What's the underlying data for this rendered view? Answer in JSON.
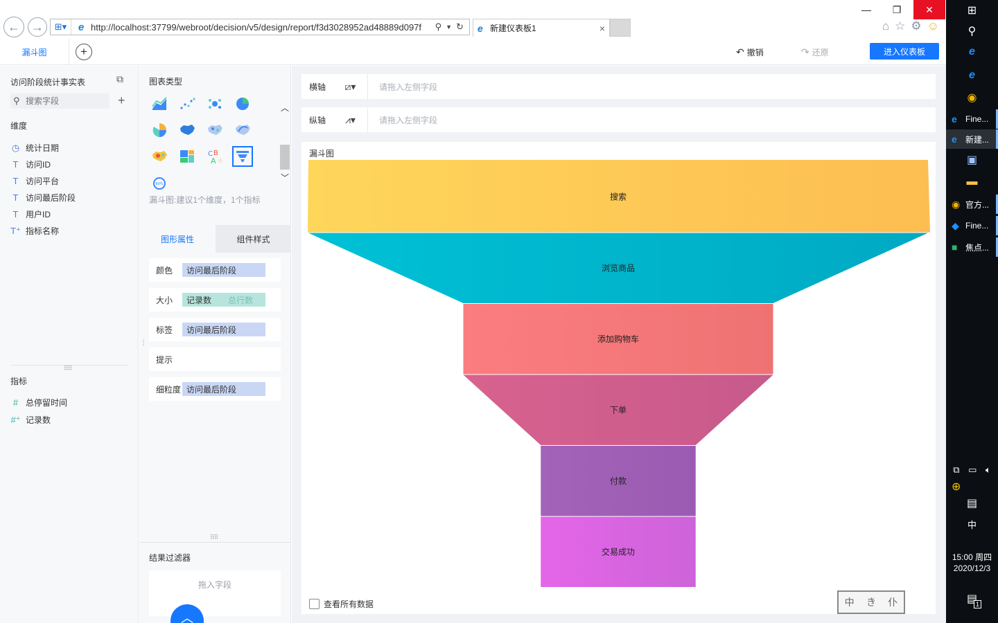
{
  "browser": {
    "url": "http://localhost:37799/webroot/decision/v5/design/report/f3d3028952ad48889d097f",
    "tab_title": "新建仪表板1",
    "tab_close": "×"
  },
  "header": {
    "active_tab": "漏斗图",
    "undo_label": "撤销",
    "redo_label": "还原",
    "enter_dashboard_label": "进入仪表板"
  },
  "data_panel": {
    "table_name": "访问阶段统计事实表",
    "search_placeholder": "搜索字段",
    "dimension_title": "维度",
    "dimensions": [
      {
        "icon": "clock-icon",
        "label": "统计日期"
      },
      {
        "icon": "text-field-icon",
        "label": "访问ID"
      },
      {
        "icon": "text-field-icon",
        "label": "访问平台"
      },
      {
        "icon": "text-field-icon",
        "label": "访问最后阶段"
      },
      {
        "icon": "text-field-icon",
        "label": "用户ID"
      },
      {
        "icon": "text-calc-field-icon",
        "label": "指标名称"
      }
    ],
    "metric_title": "指标",
    "metrics": [
      {
        "icon": "number-field-icon",
        "label": "总停留时间"
      },
      {
        "icon": "number-calc-field-icon",
        "label": "记录数"
      }
    ]
  },
  "config_panel": {
    "chart_type_title": "图表类型",
    "chart_types": [
      {
        "name": "area-chart-icon"
      },
      {
        "name": "scatter-chart-icon"
      },
      {
        "name": "bubble-chart-icon"
      },
      {
        "name": "pie-chart-icon"
      },
      {
        "name": "multi-pie-chart-icon"
      },
      {
        "name": "area-map-icon"
      },
      {
        "name": "point-map-icon"
      },
      {
        "name": "flow-map-icon"
      },
      {
        "name": "heat-map-icon"
      },
      {
        "name": "rect-tree-icon"
      },
      {
        "name": "word-cloud-icon"
      },
      {
        "name": "funnel-chart-icon"
      },
      {
        "name": "gauge-chart-icon"
      }
    ],
    "type_hint": "漏斗图:建议1个维度，1个指标",
    "tab_shape": "图形属性",
    "tab_style": "组件样式",
    "props": [
      {
        "label": "颜色",
        "value": "访问最后阶段"
      },
      {
        "label": "大小",
        "value": "记录数",
        "secondary": "总行数"
      },
      {
        "label": "标签",
        "value": "访问最后阶段"
      },
      {
        "label": "提示",
        "value": ""
      },
      {
        "label": "细粒度",
        "value": "访问最后阶段"
      }
    ],
    "filter_title": "结果过滤器",
    "filter_drop": "拖入字段"
  },
  "main": {
    "x_axis_label": "横轴",
    "y_axis_label": "纵轴",
    "axis_placeholder": "请拖入左侧字段",
    "view_all_label": "查看所有数据",
    "stamp_chars": [
      "中",
      "き",
      "仆"
    ]
  },
  "chart_data": {
    "type": "funnel",
    "title": "漏斗图",
    "categories": [
      "搜索",
      "浏览商品",
      "添加购物车",
      "下单",
      "付款",
      "交易成功"
    ],
    "values": [
      100,
      50,
      50,
      25,
      25,
      25
    ],
    "colors": [
      [
        "#fed65a",
        "#fdbd52"
      ],
      [
        "#00c1d6",
        "#00a9c3"
      ],
      [
        "#fb7d80",
        "#ef7273"
      ],
      [
        "#d8628e",
        "#c75a8c"
      ],
      [
        "#a363b7",
        "#9b5bb3"
      ],
      [
        "#e466e8",
        "#cd63d9"
      ]
    ]
  },
  "taskbar": {
    "apps": [
      {
        "icon": "ie-icon",
        "label": "Fine..."
      },
      {
        "icon": "ie-icon",
        "label": "新建..."
      },
      {
        "icon": "chrome-icon",
        "label": "官方..."
      },
      {
        "icon": "finebi-icon",
        "label": "Fine..."
      },
      {
        "icon": "wechat-work-icon",
        "label": "焦点..."
      }
    ],
    "ime": "中",
    "time": "15:00 周四",
    "date": "2020/12/3",
    "notif_count": "1"
  }
}
